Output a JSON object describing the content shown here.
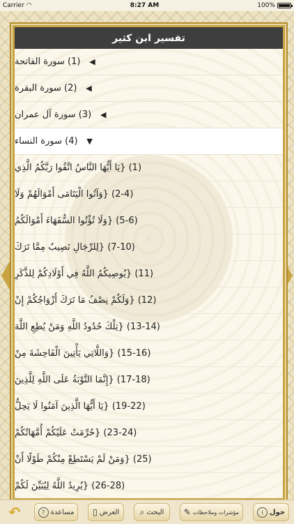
{
  "status": {
    "carrier": "Carrier",
    "time": "8:27 AM",
    "battery": "100%"
  },
  "title": "تفسير ابن كثير",
  "surahs": [
    {
      "label": "(1) سورة الفاتحة",
      "state": "collapsed"
    },
    {
      "label": "(2) سورة البقرة",
      "state": "collapsed"
    },
    {
      "label": "(3) سورة آل عمران",
      "state": "collapsed"
    },
    {
      "label": "(4) سورة النساء",
      "state": "expanded"
    }
  ],
  "verses": [
    "(1) {يَا أَيُّهَا النَّاسُ اتَّقُوا رَبَّكُمُ الَّذِي",
    "(2-4) {وَآتُوا الْيَتَامَى أَمْوَالَهُمْ وَلَا",
    "(5-6) {وَلَا تُؤْتُوا السُّفَهَاءَ أَمْوَالَكُمُ",
    "(7-10) {لِلرِّجَالِ نَصِيبٌ مِمَّا تَرَكَ",
    "(11) {يُوصِيكُمُ اللَّهُ فِي أَوْلَادِكُمْ لِلذَّكَرِ",
    "(12) {وَلَكُمْ نِصْفُ مَا تَرَكَ أَزْوَاجُكُمْ إِنْ",
    "(13-14) {تِلْكَ حُدُودُ اللَّهِ وَمَنْ يُطِعِ اللَّهَ",
    "(15-16) {وَاللَّاتِي يَأْتِينَ الْفَاحِشَةَ مِنْ",
    "(17-18) {إِنَّمَا التَّوْبَةُ عَلَى اللَّهِ لِلَّذِينَ",
    "(19-22) {يَا أَيُّهَا الَّذِينَ آمَنُوا لَا يَحِلُّ",
    "(23-24) {حُرِّمَتْ عَلَيْكُمْ أُمَّهَاتُكُمْ",
    "(25) {وَمَنْ لَمْ يَسْتَطِعْ مِنْكُمْ طَوْلًا أَنْ",
    "(26-28) {يُرِيدُ اللَّهُ لِيُبَيِّنَ لَكُمْ"
  ],
  "toolbar": {
    "about": "حول",
    "bookmarks": "مؤشرات وملاحظات",
    "search": "البحث",
    "display": "العرض",
    "help": "مساعدة"
  }
}
